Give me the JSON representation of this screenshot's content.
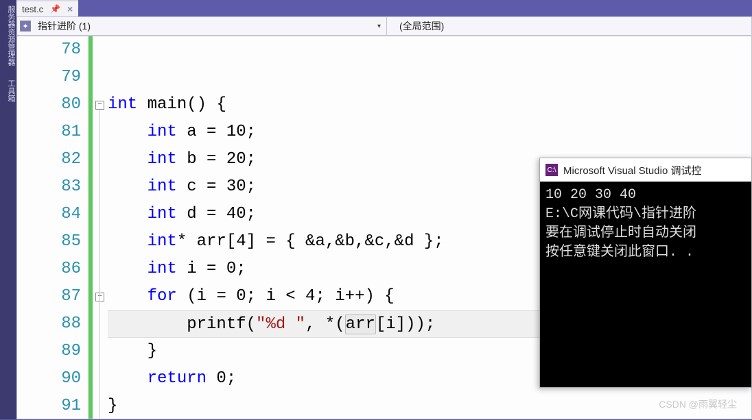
{
  "sidebar": {
    "items": [
      "服务器资源管理器",
      "工具箱"
    ]
  },
  "tab": {
    "filename": "test.c"
  },
  "nav": {
    "left": "指针进阶 (1)",
    "right": "(全局范围)"
  },
  "code": {
    "lines": [
      {
        "num": "78",
        "html": ""
      },
      {
        "num": "79",
        "html": ""
      },
      {
        "num": "80",
        "html": "<span class=\"kw\">int</span> <span class=\"fn\">main</span>() {"
      },
      {
        "num": "81",
        "html": "    <span class=\"kw\">int</span> a = 10;"
      },
      {
        "num": "82",
        "html": "    <span class=\"kw\">int</span> b = 20;"
      },
      {
        "num": "83",
        "html": "    <span class=\"kw\">int</span> c = 30;"
      },
      {
        "num": "84",
        "html": "    <span class=\"kw\">int</span> d = 40;"
      },
      {
        "num": "85",
        "html": "    <span class=\"kw\">int</span>* arr[4] = { &amp;a,&amp;b,&amp;c,&amp;d };"
      },
      {
        "num": "86",
        "html": "    <span class=\"kw\">int</span> i = 0;"
      },
      {
        "num": "87",
        "html": "    <span class=\"kw\">for</span> (i = 0; i &lt; 4; i++) {"
      },
      {
        "num": "88",
        "html": "        <span class=\"fn\">printf</span>(<span class=\"str\">\"%d \"</span>, *(<span class=\"box-highlight\">arr</span>[i]));"
      },
      {
        "num": "89",
        "html": "    }"
      },
      {
        "num": "90",
        "html": "    <span class=\"kw\">return</span> 0;"
      },
      {
        "num": "91",
        "html": "}"
      }
    ]
  },
  "console": {
    "title": "Microsoft Visual Studio 调试控",
    "lines": [
      "10 20 30 40",
      "E:\\C网课代码\\指针进阶",
      "要在调试停止时自动关闭",
      "按任意键关闭此窗口. ."
    ]
  },
  "watermark": "CSDN @雨翼轻尘"
}
